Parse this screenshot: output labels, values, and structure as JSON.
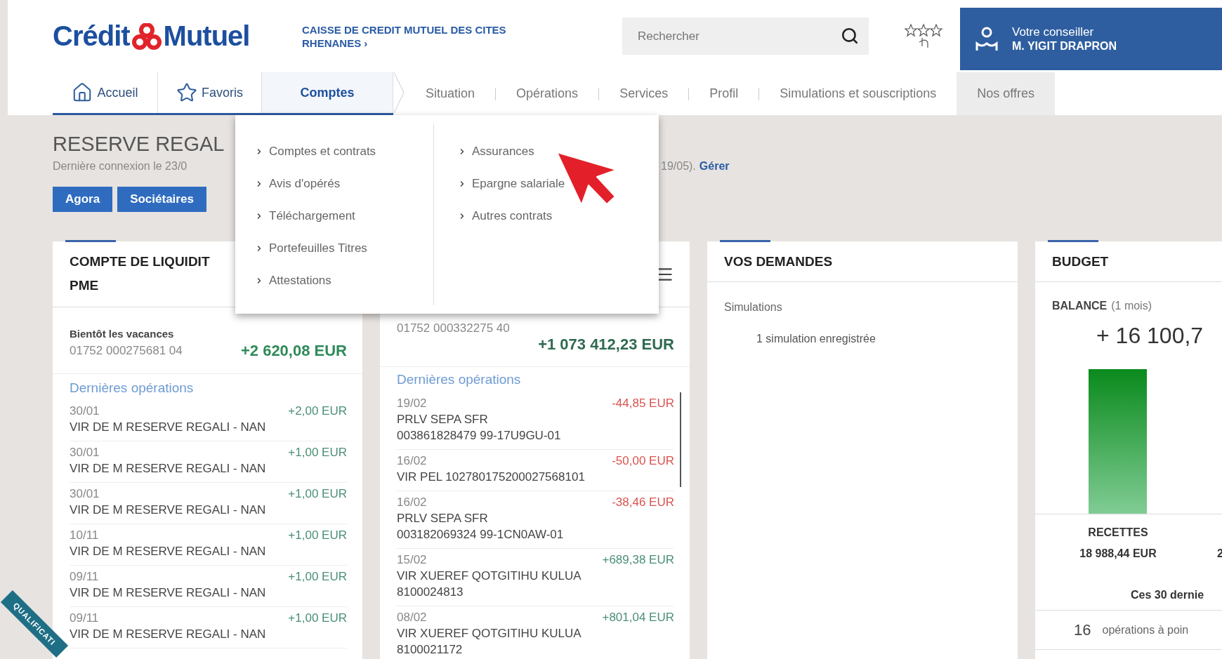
{
  "header": {
    "logo": {
      "left": "Crédit",
      "right": "Mutuel"
    },
    "bank_name": [
      "CAISSE DE CREDIT MUTUEL DES CITES",
      "RHENANES ›"
    ],
    "search": {
      "placeholder": "Rechercher"
    },
    "advisor": {
      "label": "Votre conseiller",
      "name": "M. YIGIT DRAPRON"
    }
  },
  "nav": [
    {
      "label": "Accueil",
      "kind": "home",
      "selected": false
    },
    {
      "label": "Favoris",
      "kind": "star",
      "selected": false
    },
    {
      "label": "Comptes",
      "kind": "section",
      "selected": true
    },
    {
      "label": "Situation",
      "kind": "sub",
      "selected": false
    },
    {
      "label": "Opérations",
      "kind": "sub",
      "selected": false
    },
    {
      "label": "Services",
      "kind": "sub",
      "selected": false
    },
    {
      "label": "Profil",
      "kind": "sub",
      "selected": false
    },
    {
      "label": "Simulations et souscriptions",
      "kind": "sub",
      "selected": false
    },
    {
      "label": "Nos offres",
      "kind": "offer",
      "selected": false
    }
  ],
  "dropdown": {
    "columns": [
      [
        "Comptes et contrats",
        "Avis d'opérés",
        "Téléchargement",
        "Portefeuilles Titres",
        "Attestations"
      ],
      [
        "Assurances",
        "Epargne salariale",
        "Autres contrats"
      ]
    ]
  },
  "owner": {
    "name": "RESERVE REGAL",
    "last_login": "Dernière connexion le 23/0",
    "last_login_end": "19/05).",
    "manage_link": "Gérer",
    "tags": [
      "Agora",
      "Sociétaires"
    ]
  },
  "liquidity_card": {
    "title_lines": [
      "COMPTE DE LIQUIDIT",
      "PME"
    ],
    "account_label": "Bientôt les vacances",
    "account_number": "01752 000275681 04",
    "balance": "+2 620,08 EUR",
    "ops_title": "Dernières opérations",
    "ops": [
      {
        "date": "30/01",
        "amount": "+2,00 EUR",
        "kind": "credit",
        "lines": [
          "VIR DE M RESERVE REGALI - NAN"
        ]
      },
      {
        "date": "30/01",
        "amount": "+1,00 EUR",
        "kind": "credit",
        "lines": [
          "VIR DE M RESERVE REGALI - NAN"
        ]
      },
      {
        "date": "30/01",
        "amount": "+1,00 EUR",
        "kind": "credit",
        "lines": [
          "VIR DE M RESERVE REGALI - NAN"
        ]
      },
      {
        "date": "10/11",
        "amount": "+1,00 EUR",
        "kind": "credit",
        "lines": [
          "VIR DE M RESERVE REGALI - NAN"
        ]
      },
      {
        "date": "09/11",
        "amount": "+1,00 EUR",
        "kind": "credit",
        "lines": [
          "VIR DE M RESERVE REGALI - NAN"
        ]
      },
      {
        "date": "09/11",
        "amount": "+1,00 EUR",
        "kind": "credit",
        "lines": [
          "VIR DE M RESERVE REGALI - NAN"
        ]
      }
    ]
  },
  "account_card": {
    "account_number": "01752 000332275 40",
    "balance": "+1 073 412,23 EUR",
    "ops_title": "Dernières opérations",
    "ops": [
      {
        "date": "19/02",
        "amount": "-44,85 EUR",
        "kind": "debit",
        "lines": [
          "PRLV SEPA SFR",
          "003861828479 99-17U9GU-01"
        ]
      },
      {
        "date": "16/02",
        "amount": "-50,00 EUR",
        "kind": "debit",
        "lines": [
          "VIR PEL 102780175200027568101"
        ]
      },
      {
        "date": "16/02",
        "amount": "-38,46 EUR",
        "kind": "debit",
        "lines": [
          "PRLV SEPA SFR",
          "003182069324 99-1CN0AW-01"
        ]
      },
      {
        "date": "15/02",
        "amount": "+689,38 EUR",
        "kind": "credit",
        "lines": [
          "VIR XUEREF QOTGITIHU KULUA",
          "8100024813"
        ]
      },
      {
        "date": "08/02",
        "amount": "+801,04 EUR",
        "kind": "credit",
        "lines": [
          "VIR XUEREF QOTGITIHU KULUA",
          "8100021172"
        ]
      }
    ]
  },
  "requests_card": {
    "title": "VOS DEMANDES",
    "section": "Simulations",
    "item": "1 simulation enregistrée"
  },
  "budget_card": {
    "title": "BUDGET",
    "balance_label": "BALANCE",
    "balance_period": "(1 mois)",
    "balance": "+ 16 100,7",
    "income_label": "RECETTES",
    "income": "18 988,44 EUR",
    "column_2": "2",
    "period": "Ces 30 dernie",
    "pending_count": "16",
    "pending_text": "opérations à poin"
  },
  "ribbon": "QUALIFICATI"
}
